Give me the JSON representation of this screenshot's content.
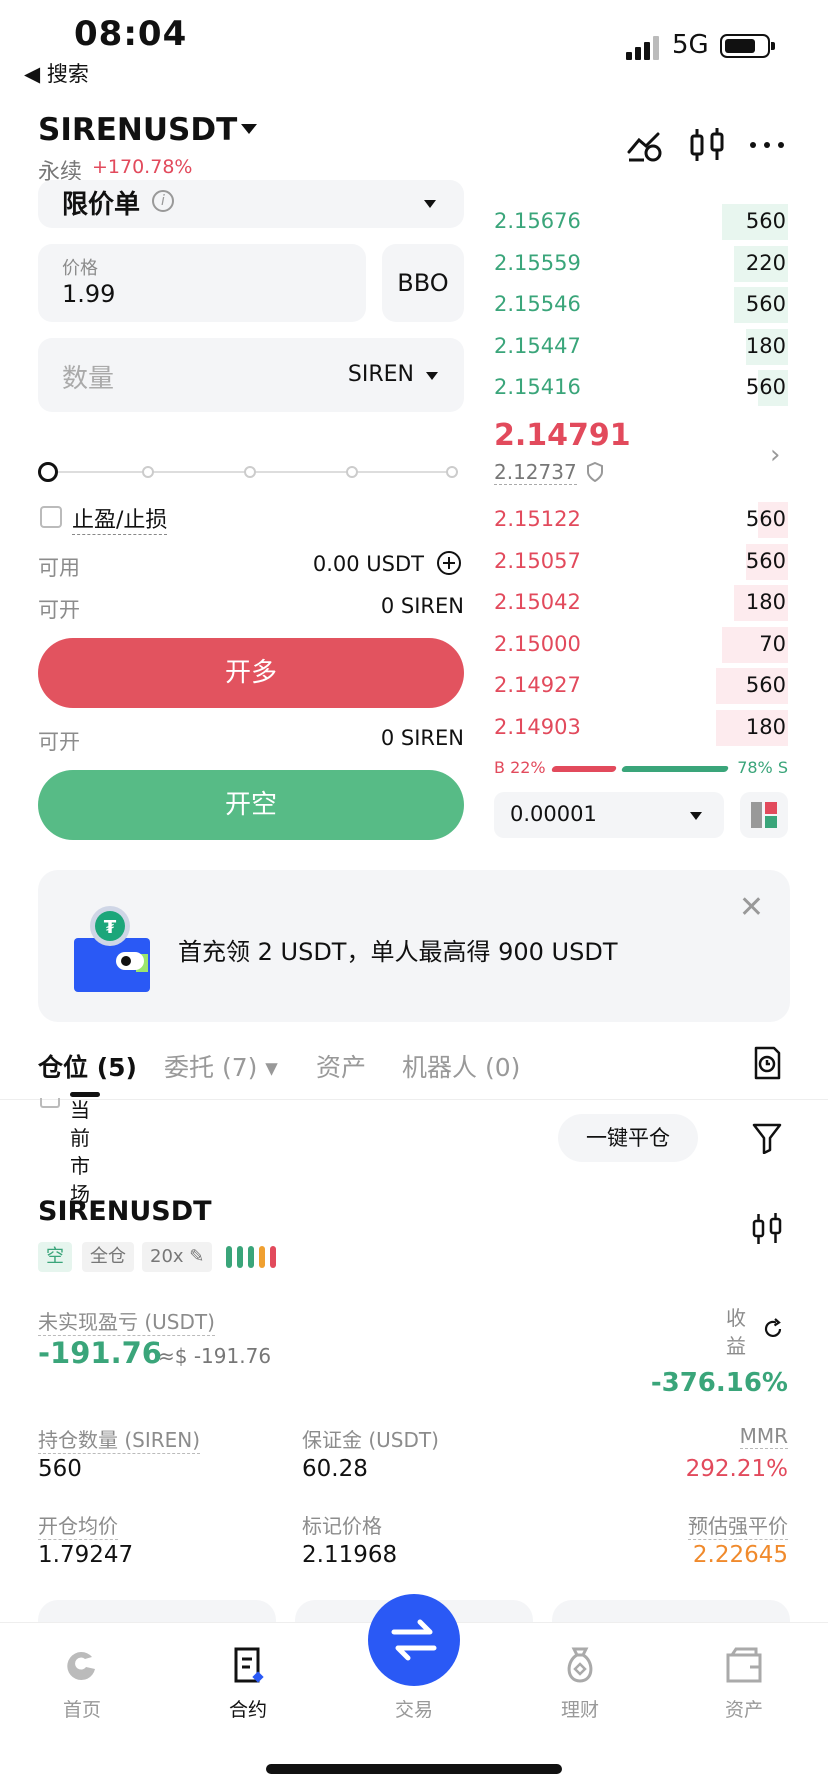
{
  "status_bar": {
    "time": "08:04",
    "back_label": "◀ 搜索",
    "network": "5G"
  },
  "header": {
    "symbol": "SIRENUSDT",
    "contract_type": "永续",
    "change": "+170.78%",
    "icons": [
      "indicator-icon",
      "candlestick-icon",
      "more-icon"
    ]
  },
  "order_form": {
    "order_type": "限价单",
    "price_label": "价格",
    "price_value": "1.99",
    "bbo_label": "BBO",
    "qty_placeholder": "数量",
    "qty_unit": "SIREN",
    "tpsl_label": "止盈/止损",
    "available_label": "可用",
    "available_value": "0.00 USDT",
    "can_open_label": "可开",
    "can_open_long": "0 SIREN",
    "long_button": "开多",
    "can_open_short": "0 SIREN",
    "short_button": "开空"
  },
  "order_book": {
    "asks": [
      {
        "price": "2.15676",
        "qty": "560",
        "depth": 0.22
      },
      {
        "price": "2.15559",
        "qty": "220",
        "depth": 0.18
      },
      {
        "price": "2.15546",
        "qty": "560",
        "depth": 0.18
      },
      {
        "price": "2.15447",
        "qty": "180",
        "depth": 0.14
      },
      {
        "price": "2.15416",
        "qty": "560",
        "depth": 0.1
      }
    ],
    "last_price": "2.14791",
    "mark_price": "2.12737",
    "bids": [
      {
        "price": "2.15122",
        "qty": "560",
        "depth": 0.1
      },
      {
        "price": "2.15057",
        "qty": "560",
        "depth": 0.14
      },
      {
        "price": "2.15042",
        "qty": "180",
        "depth": 0.18
      },
      {
        "price": "2.15000",
        "qty": "70",
        "depth": 0.22
      },
      {
        "price": "2.14927",
        "qty": "560",
        "depth": 0.24
      },
      {
        "price": "2.14903",
        "qty": "180",
        "depth": 0.24
      }
    ],
    "buy_ratio": "B 22%",
    "sell_ratio": "78% S",
    "precision": "0.00001"
  },
  "banner": {
    "text": "首充领 2 USDT，单人最高得 900 USDT"
  },
  "tabs": [
    {
      "label": "仓位 (5)",
      "active": true
    },
    {
      "label": "委托 (7) ▾",
      "active": false
    },
    {
      "label": "资产",
      "active": false
    },
    {
      "label": "机器人 (0)",
      "active": false
    }
  ],
  "position_list": {
    "current_market_label": "当前市场",
    "close_all_button": "一键平仓"
  },
  "position": {
    "symbol": "SIRENUSDT",
    "side_tag": "空",
    "margin_mode_tag": "全仓",
    "leverage_tag": "20x ✎",
    "risk_colors": [
      "#3aa57a",
      "#3aa57a",
      "#3aa57a",
      "#f0a030",
      "#e24a5c"
    ],
    "upnl_label": "未实现盈亏 (USDT)",
    "upnl_value": "-191.76",
    "upnl_usd": "≈$ -191.76",
    "roe_label": "收益",
    "roe_value": "-376.16%",
    "size_label": "持仓数量 (SIREN)",
    "size_value": "560",
    "margin_label": "保证金 (USDT)",
    "margin_value": "60.28",
    "mmr_label": "MMR",
    "mmr_value": "292.21%",
    "entry_label": "开仓均价",
    "entry_value": "1.79247",
    "mark_label": "标记价格",
    "mark_value": "2.11968",
    "liq_label": "预估强平价",
    "liq_value": "2.22645"
  },
  "bottom_nav": [
    {
      "label": "首页",
      "icon": "home-icon"
    },
    {
      "label": "合约",
      "icon": "contract-icon",
      "active": true
    },
    {
      "label": "交易",
      "icon": "trade-swap-icon"
    },
    {
      "label": "理财",
      "icon": "earn-icon"
    },
    {
      "label": "资产",
      "icon": "wallet-icon"
    }
  ]
}
